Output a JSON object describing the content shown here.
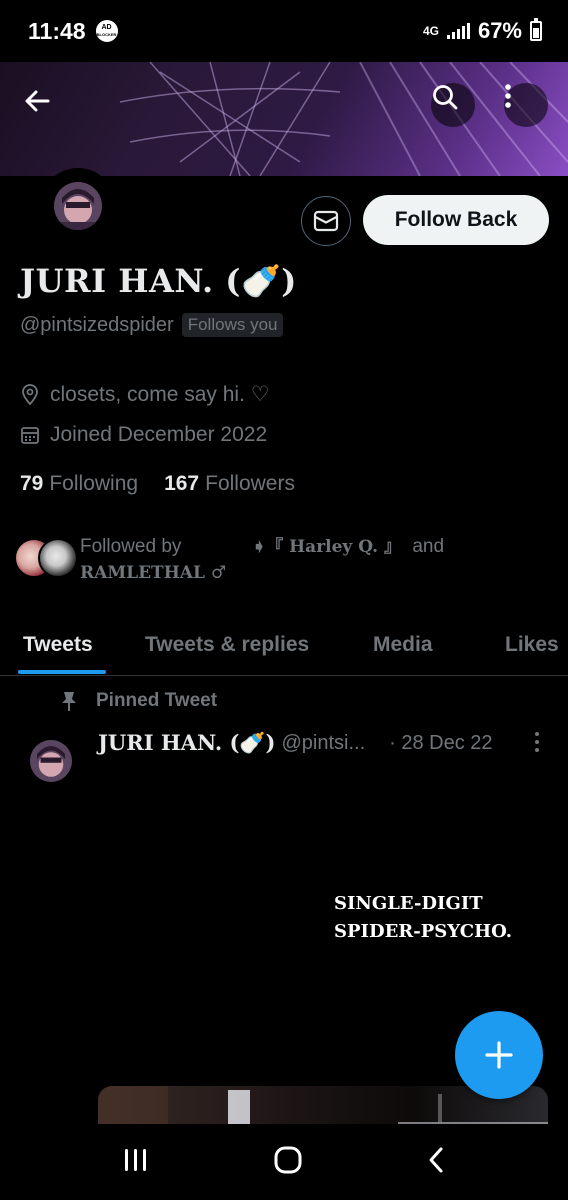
{
  "status_bar": {
    "time": "11:48",
    "ad_label_top": "AD",
    "ad_label_bottom": "BLOCKER",
    "network": "4G",
    "battery": "67%"
  },
  "profile": {
    "display_name": "JURI HAN. (🍼)",
    "handle": "@pintsizedspider",
    "follows_you": "Follows you",
    "location": "closets, come say hi. ♡",
    "joined": "Joined December 2022",
    "following_count": "79",
    "following_label": "Following",
    "followers_count": "167",
    "followers_label": "Followers",
    "follow_button": "Follow Back"
  },
  "followed_by": {
    "prefix": "Followed by",
    "name_one": "➧『 Harley Q. 』",
    "conjunction": "and",
    "name_two": "RAMLETHAL ♂"
  },
  "tabs": [
    {
      "label": "Tweets",
      "active": true
    },
    {
      "label": "Tweets & replies",
      "active": false
    },
    {
      "label": "Media",
      "active": false
    },
    {
      "label": "Likes",
      "active": false
    }
  ],
  "pinned_tweet": {
    "pinned_label": "Pinned Tweet",
    "author_name": "JURI HAN. (🍼)",
    "author_handle": "@pintsi...",
    "date": "· 28 Dec 22",
    "text_line1": "SINGLE-DIGIT",
    "text_line2": "SPIDER-PSYCHO."
  },
  "colors": {
    "accent": "#1d9bf0",
    "muted": "#71767b",
    "text": "#e7e9ea",
    "border": "#2f3336"
  },
  "icons": [
    "back-arrow-icon",
    "search-icon",
    "more-vertical-icon",
    "envelope-icon",
    "location-pin-icon",
    "calendar-icon",
    "pin-icon",
    "plus-icon",
    "recents-icon",
    "home-icon",
    "back-nav-icon"
  ]
}
